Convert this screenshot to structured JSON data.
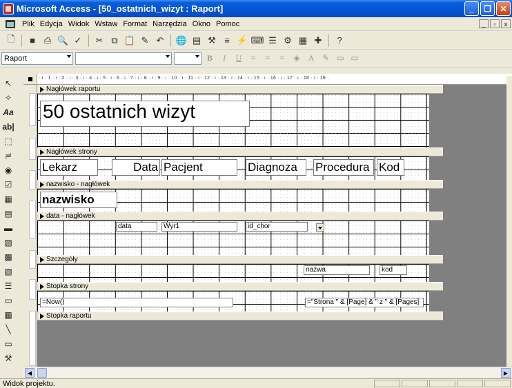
{
  "window": {
    "title": "Microsoft Access - [50_ostatnich_wizyt : Raport]"
  },
  "menu": {
    "items": [
      "Plik",
      "Edycja",
      "Widok",
      "Wstaw",
      "Format",
      "Narzędzia",
      "Okno",
      "Pomoc"
    ]
  },
  "toolbar": {
    "object_combo": "Raport"
  },
  "sections": {
    "report_header": "Nagłówek raportu",
    "page_header": "Nagłówek strony",
    "name_header": "nazwisko - nagłówek",
    "date_header": "data - nagłówek",
    "detail": "Szczegóły",
    "page_footer": "Stopka strony",
    "report_footer": "Stopka raportu"
  },
  "controls": {
    "report_title": "50 ostatnich wizyt",
    "col_lekarz": "Lekarz",
    "col_data": "Data",
    "col_pacjent": "Pacjent",
    "col_diagnoza": "Diagnoza",
    "col_procedura": "Procedura",
    "col_kod": "Kod",
    "nazwisko": "nazwisko",
    "data_field": "data",
    "wyr1_field": "Wyr1",
    "id_chor_field": "id_chor",
    "nazwa_field": "nazwa",
    "kod_field": "kod",
    "now_field": "=Now()",
    "page_field": "=\"Strona \" & [Page] & \" z \" & [Pages]"
  },
  "ruler": {
    "ticks": "· ı · 1 · ı · 2 · ı · 3 · ı · 4 · ı · 5 · ı · 6 · ı · 7 · ı · 8 · ı · 9 · ı · 10 · ı · 11 · ı · 12 · ı · 13 · ı · 14 · ı · 15 · ı · 16 · ı · 17 · ı · 18 · ı · 19 ·"
  },
  "status": {
    "text": "Widok projektu."
  }
}
